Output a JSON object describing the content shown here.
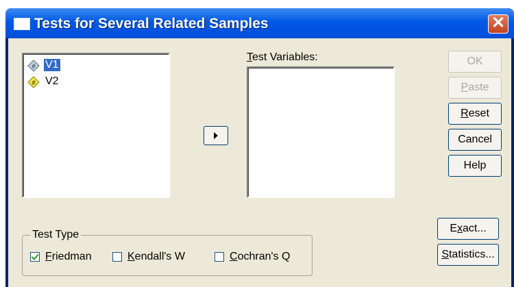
{
  "window": {
    "title": "Tests for Several Related Samples",
    "close_label": "✕"
  },
  "source_list": {
    "items": [
      {
        "label": "V1",
        "icon": "scale-diamond-icon",
        "selected": true
      },
      {
        "label": "V2",
        "icon": "nominal-diamond-icon",
        "selected": false
      }
    ]
  },
  "test_variables": {
    "label_mnemonic": "T",
    "label_rest": "est Variables:"
  },
  "buttons": {
    "ok": {
      "label": "OK",
      "enabled": false
    },
    "paste": {
      "mnemonic": "P",
      "rest": "aste",
      "enabled": false
    },
    "reset": {
      "mnemonic": "R",
      "rest": "eset",
      "enabled": true
    },
    "cancel": {
      "label": "Cancel",
      "enabled": true
    },
    "help": {
      "label": "Help",
      "enabled": true
    },
    "exact": {
      "pre": "E",
      "mnemonic": "x",
      "rest": "act...",
      "enabled": true
    },
    "statistics": {
      "mnemonic": "S",
      "rest": "tatistics...",
      "enabled": true
    }
  },
  "test_type": {
    "title": "Test Type",
    "options": [
      {
        "mnemonic": "F",
        "rest": "riedman",
        "checked": true
      },
      {
        "mnemonic": "K",
        "rest": "endall's W",
        "checked": false
      },
      {
        "mnemonic": "C",
        "rest": "ochran's Q",
        "checked": false
      }
    ]
  },
  "colors": {
    "selection": "#316ac5",
    "face": "#ece9d8",
    "titlebar": "#0058e6"
  }
}
